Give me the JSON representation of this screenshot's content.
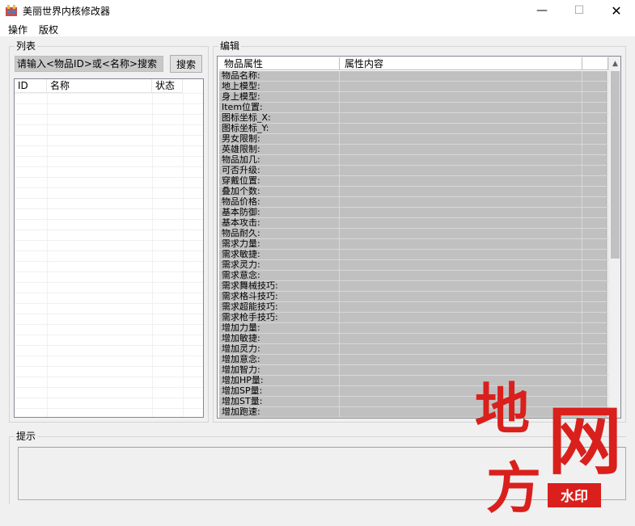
{
  "window": {
    "title": "美丽世界内核修改器",
    "controls": {
      "minimize": "—",
      "maximize": "☐",
      "close": "✕"
    }
  },
  "menu": {
    "items": [
      "操作",
      "版权"
    ]
  },
  "list_panel": {
    "caption": "列表",
    "search_placeholder": "请输入<物品ID>或<名称>搜索",
    "search_button": "搜索",
    "columns": [
      "ID",
      "名称",
      "状态"
    ]
  },
  "edit_panel": {
    "caption": "编辑",
    "columns": [
      "物品属性",
      "属性内容"
    ],
    "rows": [
      "物品名称:",
      "地上模型:",
      "身上模型:",
      "Item位置:",
      "图标坐标_X:",
      "图标坐标_Y:",
      "男女限制:",
      "英雄限制:",
      "物品加几:",
      "可否升级:",
      "穿戴位置:",
      "叠加个数:",
      "物品价格:",
      "基本防御:",
      "基本攻击:",
      "物品耐久:",
      "需求力量:",
      "需求敏捷:",
      "需求灵力:",
      "需求意念:",
      "需求舞械技巧:",
      "需求格斗技巧:",
      "需求超能技巧:",
      "需求枪手技巧:",
      "增加力量:",
      "增加敏捷:",
      "增加灵力:",
      "增加意念:",
      "增加智力:",
      "增加HP量:",
      "增加SP量:",
      "增加ST量:",
      "增加跑速:"
    ]
  },
  "hint_panel": {
    "caption": "提示",
    "text": ""
  },
  "watermark": {
    "chars": [
      "地",
      "方",
      "网"
    ],
    "badge": "水印",
    "color": "#d9201c"
  }
}
